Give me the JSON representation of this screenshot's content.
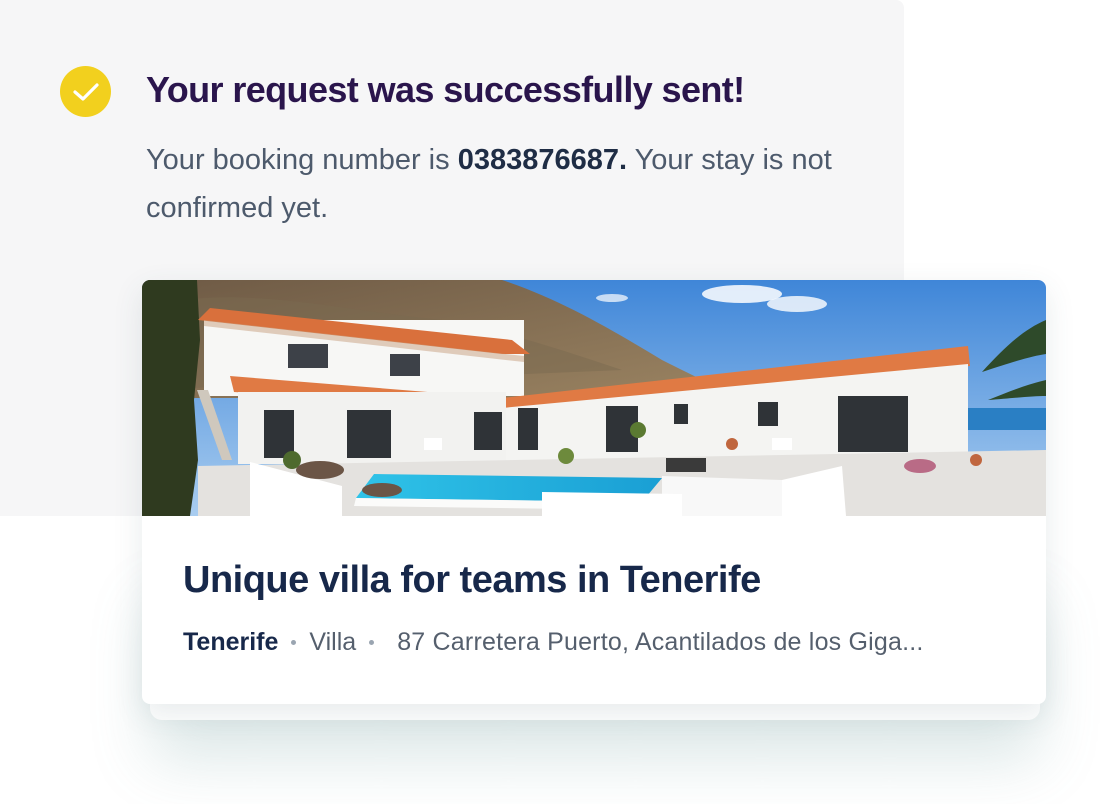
{
  "confirmation": {
    "title": "Your request was successfully sent!",
    "message_prefix": "Your booking number is ",
    "booking_number": "0383876687.",
    "message_suffix": " Your stay is not confirmed yet.",
    "icon": "check-circle-icon",
    "icon_color": "#f2d01e"
  },
  "listing": {
    "photo": "villa-photo",
    "title": "Unique villa for teams in Tenerife",
    "city": "Tenerife",
    "type": "Villa",
    "address": "87 Carretera Puerto, Acantilados de los Giga..."
  },
  "colors": {
    "title": "#2a154c",
    "body_text": "#4d5a6c",
    "panel_background": "#f6f6f7",
    "listing_title": "#17284a"
  }
}
